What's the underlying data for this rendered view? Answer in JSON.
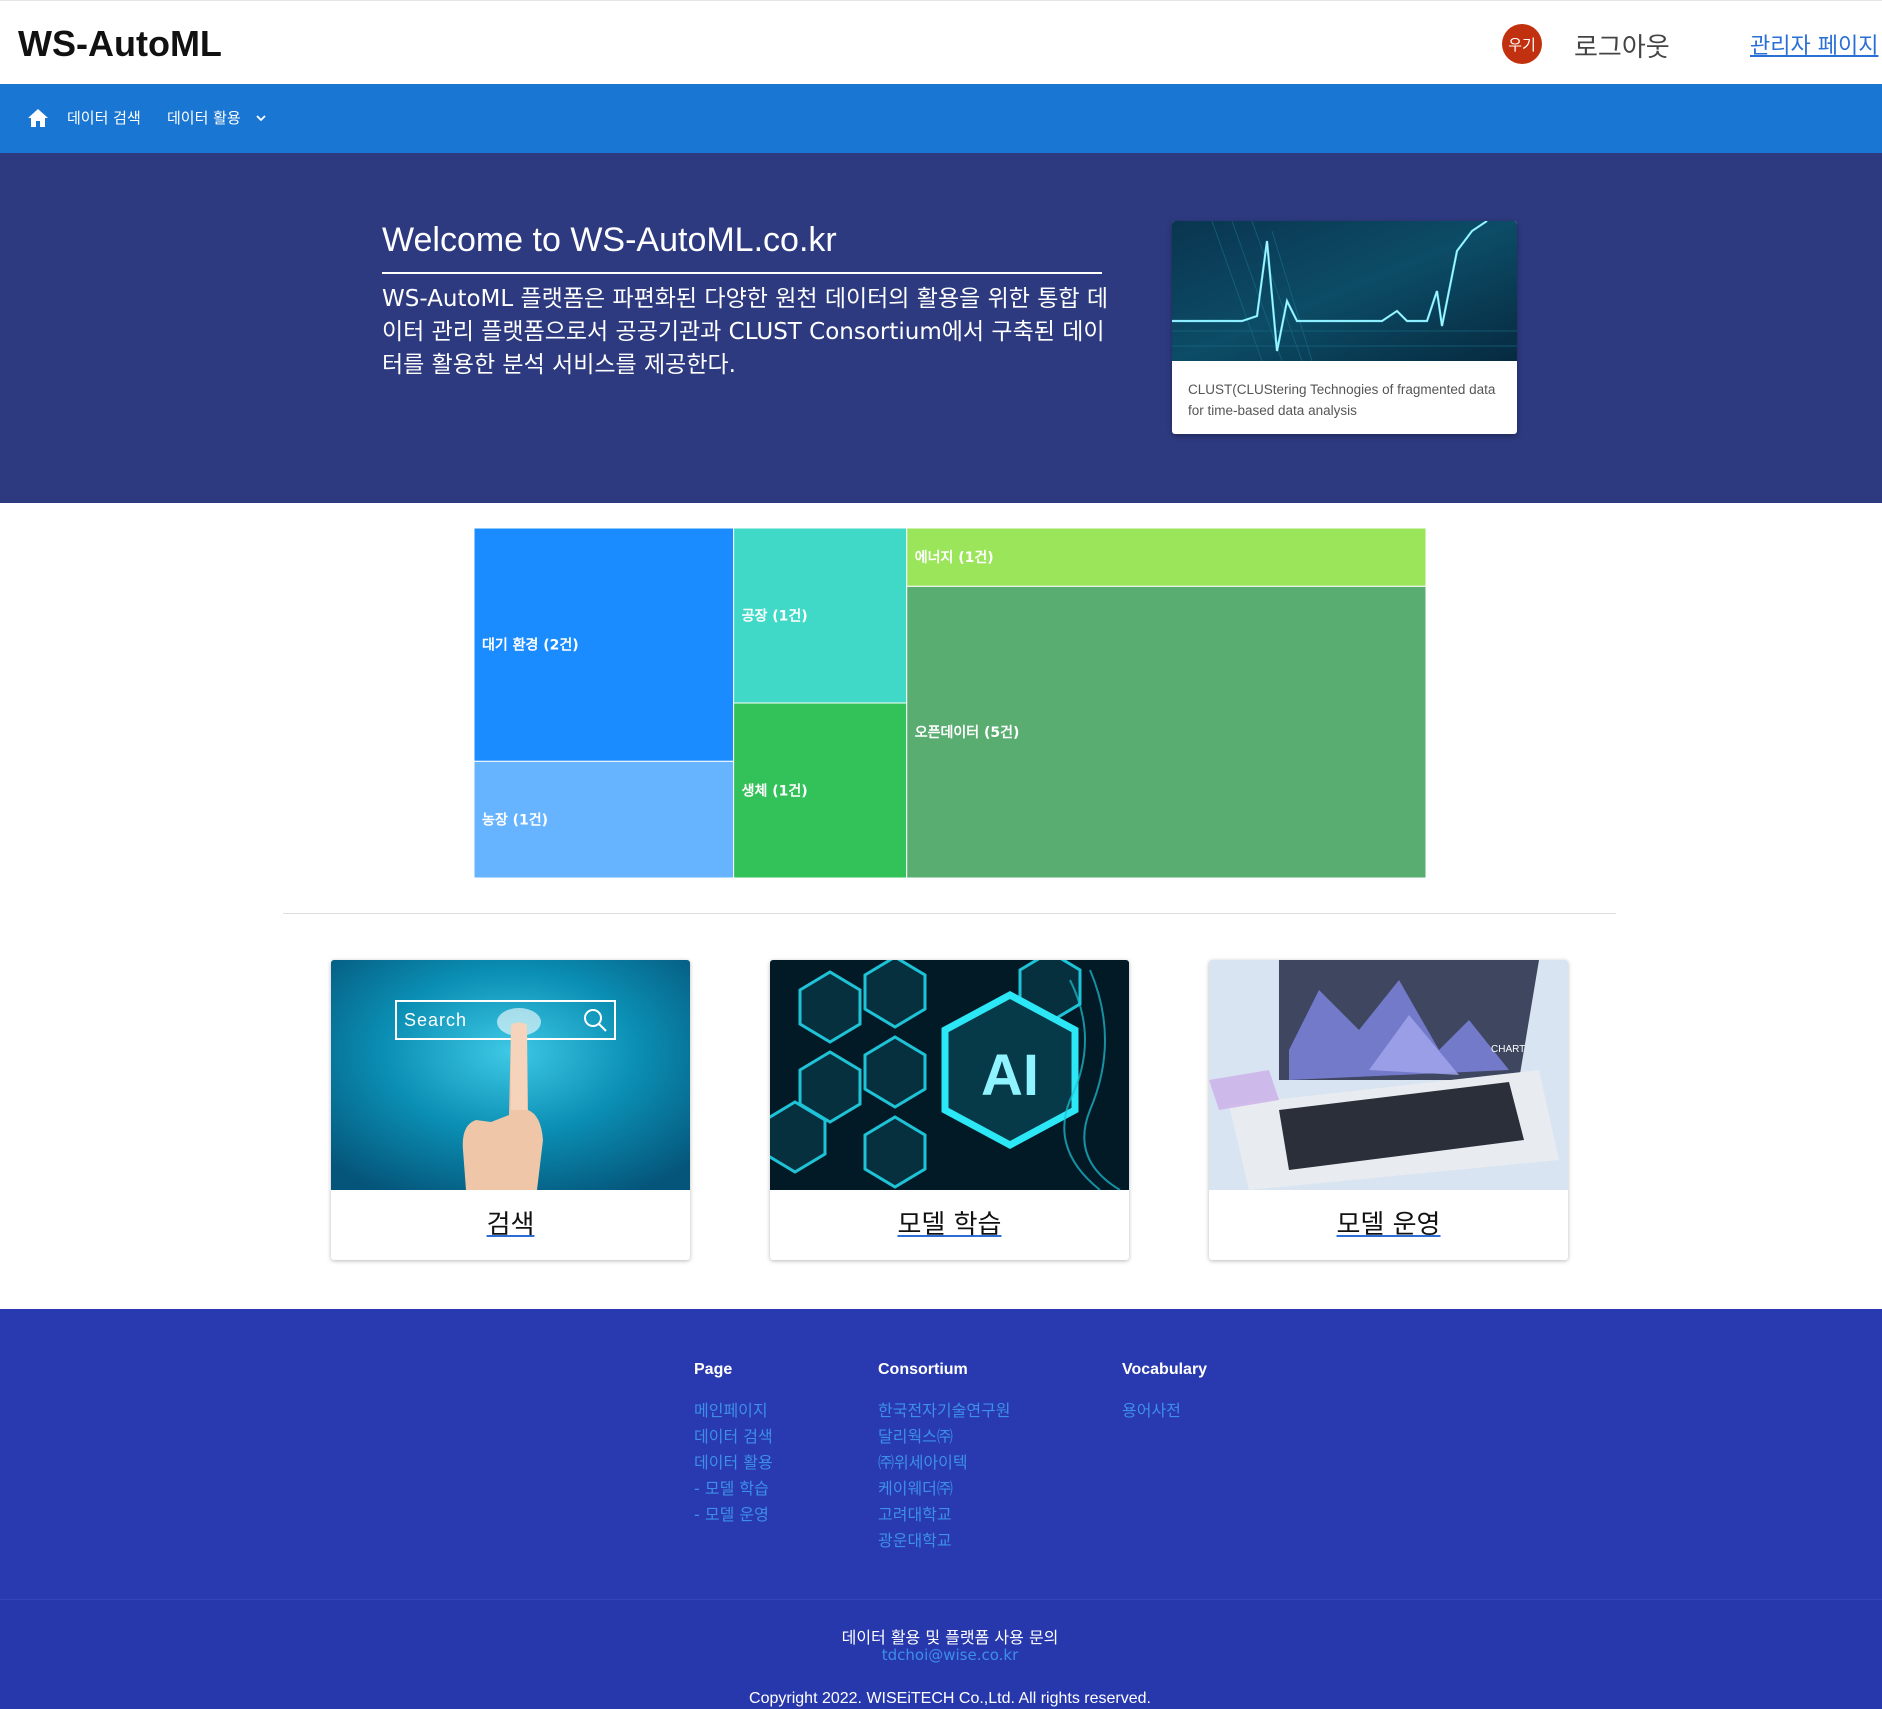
{
  "header": {
    "brand": "WS-AutoML",
    "avatar_text": "우기",
    "avatar_color": "#c2310f",
    "logout_label": "로그아웃",
    "admin_label": "관리자 페이지"
  },
  "nav": {
    "home_icon": "home-icon",
    "items": [
      {
        "label": "데이터 검색"
      },
      {
        "label": "데이터 활용"
      }
    ],
    "dropdown_icon": "chevron-down-icon",
    "background": "#1976d2"
  },
  "hero": {
    "title": "Welcome to WS-AutoML.co.kr",
    "description": "WS-AutoML 플랫폼은 파편화된 다양한 원천 데이터의 활용을 위한 통합 데이터 관리 플랫폼으로서 공공기관과 CLUST Consortium에서 구축된 데이터를 활용한 분석 서비스를 제공한다.",
    "card_caption": "CLUST(CLUStering Technogies of fragmented data for time-based data analysis",
    "background": "#2d3a7f"
  },
  "chart_data": {
    "type": "treemap",
    "items": [
      {
        "label": "대기 환경 (2건)",
        "value": 2,
        "color": "#1a8cff"
      },
      {
        "label": "농장 (1건)",
        "value": 1,
        "color": "#66b3ff"
      },
      {
        "label": "공장 (1건)",
        "value": 1,
        "color": "#40d9c7"
      },
      {
        "label": "생체 (1건)",
        "value": 1,
        "color": "#33c15a"
      },
      {
        "label": "에너지 (1건)",
        "value": 1,
        "color": "#9be55b"
      },
      {
        "label": "오픈데이터 (5건)",
        "value": 5,
        "color": "#5aad70"
      }
    ]
  },
  "cards": [
    {
      "label": "검색",
      "search_box_text": "Search"
    },
    {
      "label": "모델 학습",
      "image_text": "AI"
    },
    {
      "label": "모델 운영",
      "image_text": "CHART"
    }
  ],
  "footer": {
    "columns": [
      {
        "heading": "Page",
        "links": [
          "메인페이지",
          "데이터 검색",
          "데이터 활용",
          "- 모델 학습",
          "- 모델 운영"
        ]
      },
      {
        "heading": "Consortium",
        "links": [
          "한국전자기술연구원",
          "달리웍스㈜",
          "㈜위세아이텍",
          "케이웨더㈜",
          "고려대학교",
          "광운대학교"
        ]
      },
      {
        "heading": "Vocabulary",
        "links": [
          "용어사전"
        ]
      }
    ],
    "contact_label": "데이터 활용 및 플랫폼 사용 문의",
    "contact_email": "tdchoi@wise.co.kr",
    "copyright": "Copyright 2022. WISEiTECH Co.,Ltd. All rights reserved.",
    "background": "#2939b0"
  }
}
